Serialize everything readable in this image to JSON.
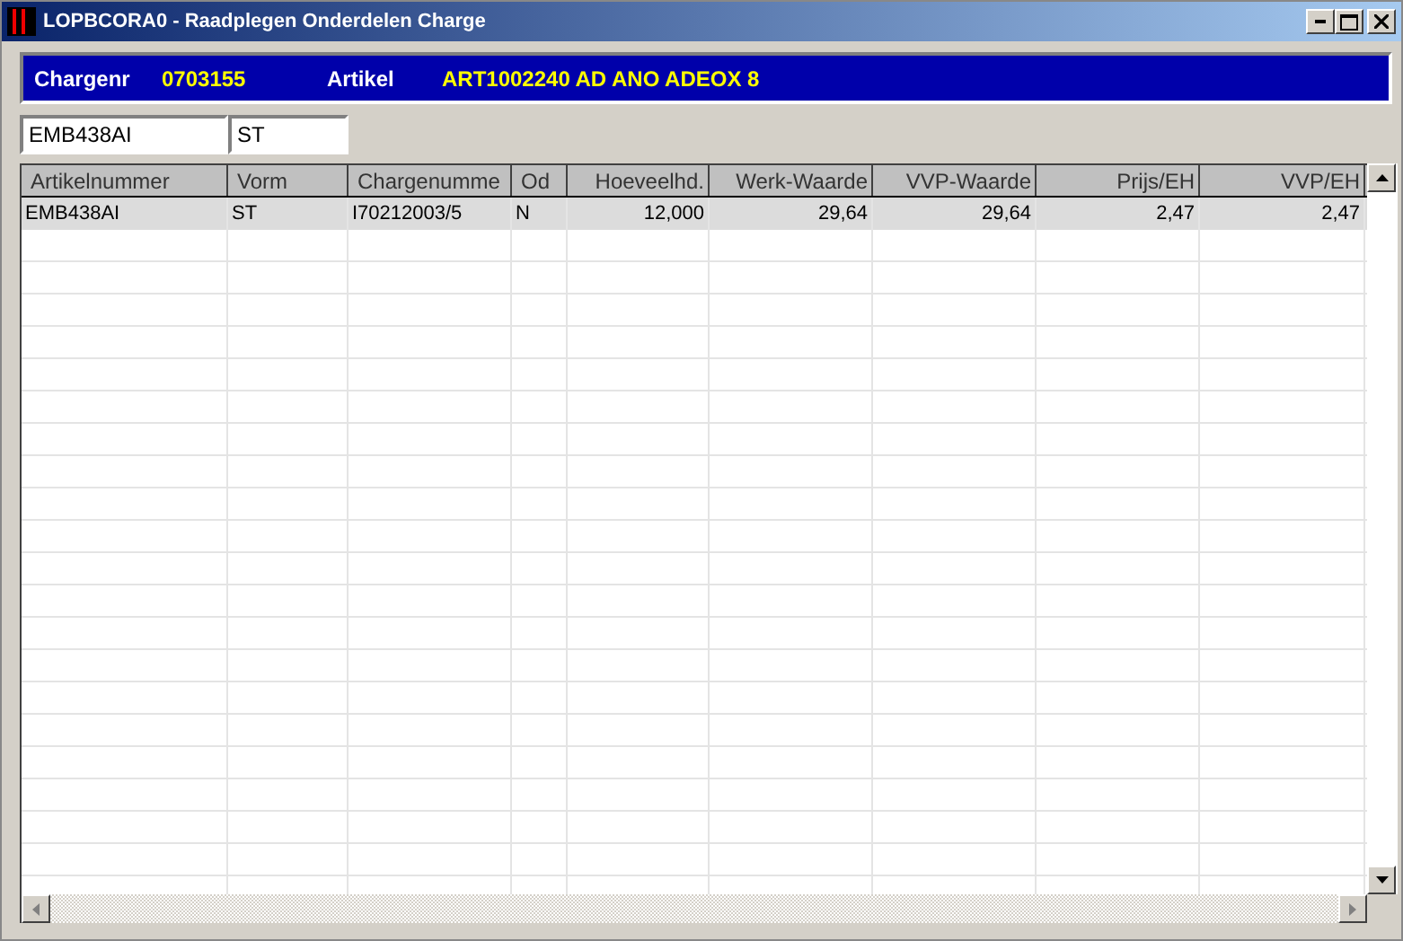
{
  "window": {
    "title": "LOPBCORA0 - Raadplegen Onderdelen Charge"
  },
  "header": [
    {
      "label": "Chargenr",
      "value": "0703155"
    },
    {
      "label": "Artikel",
      "value": "ART1002240 AD ANO ADEOX 8"
    }
  ],
  "filters": [
    {
      "value": "EMB438AI"
    },
    {
      "value": "ST"
    }
  ],
  "table": {
    "columns": [
      {
        "label": "Artikelnummer"
      },
      {
        "label": "Vorm"
      },
      {
        "label": "Chargenumme"
      },
      {
        "label": "Od"
      },
      {
        "label": "Hoeveelhd."
      },
      {
        "label": "Werk-Waarde"
      },
      {
        "label": "VVP-Waarde"
      },
      {
        "label": "Prijs/EH"
      },
      {
        "label": "VVP/EH"
      }
    ],
    "rows": [
      {
        "selected": true,
        "cells": [
          "EMB438AI",
          "ST",
          "I70212003/5",
          "N",
          "12,000",
          "29,64",
          "29,64",
          "2,47",
          "2,47"
        ]
      }
    ]
  }
}
